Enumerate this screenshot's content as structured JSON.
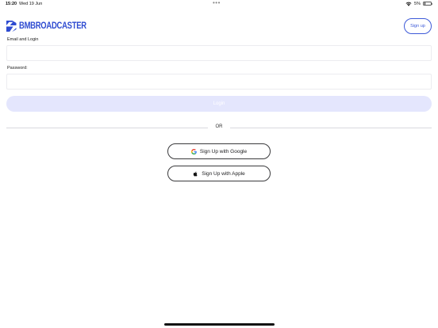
{
  "status_bar": {
    "time": "15:20",
    "date": "Wed 19 Jun",
    "dots": "•••",
    "battery_percent": "5%",
    "battery_level": 0.05,
    "wifi_icon": "wifi-icon",
    "battery_icon": "battery-icon"
  },
  "header": {
    "logo_text": "BMBROADCASTER",
    "logo_icon": "logo-mark-icon",
    "brand_color": "#2e4bd1",
    "signup_label": "Sign up"
  },
  "form": {
    "email_label": "Email and Login",
    "email_value": "",
    "email_placeholder": "",
    "password_label": "Password:",
    "password_value": "",
    "password_placeholder": "",
    "login_label": "Login",
    "login_color": "#e4e6fd"
  },
  "divider": {
    "text": "OR"
  },
  "social": {
    "google_label": "Sign Up with Google",
    "google_icon": "google-icon",
    "apple_label": "Sign Up with Apple",
    "apple_icon": "apple-icon"
  }
}
